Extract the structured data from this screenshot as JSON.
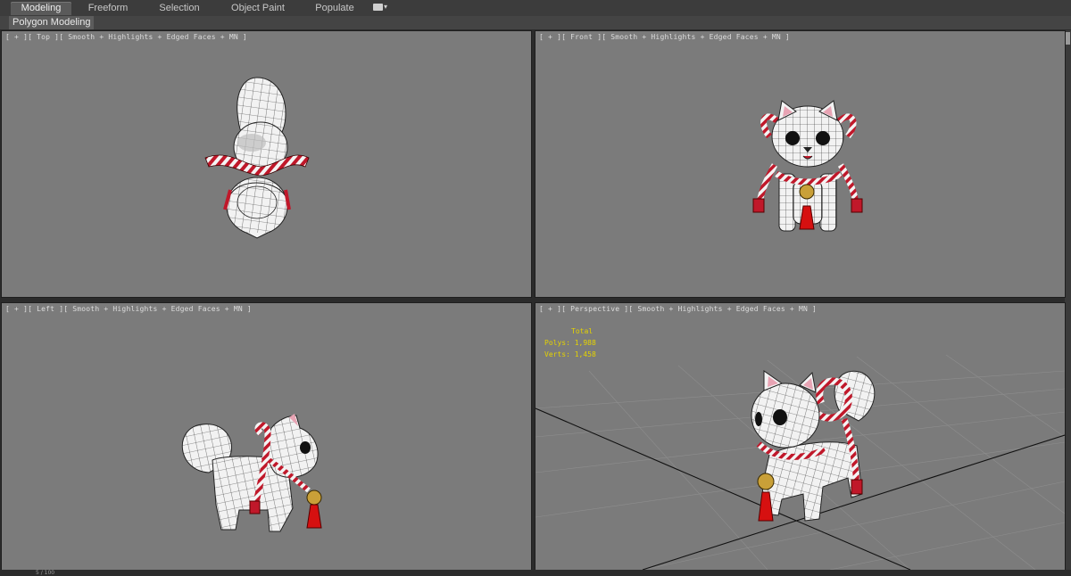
{
  "ribbon": {
    "tabs": [
      {
        "label": "Modeling",
        "active": true
      },
      {
        "label": "Freeform",
        "active": false
      },
      {
        "label": "Selection",
        "active": false
      },
      {
        "label": "Object Paint",
        "active": false
      },
      {
        "label": "Populate",
        "active": false
      }
    ],
    "dropdown_icon": "display-options-icon"
  },
  "panel": {
    "label": "Polygon Modeling"
  },
  "viewports": {
    "top": {
      "label": "[ + ][ Top ][ Smooth + Highlights + Edged Faces + MN ]"
    },
    "front": {
      "label": "[ + ][ Front ][ Smooth + Highlights + Edged Faces + MN ]"
    },
    "left": {
      "label": "[ + ][ Left ][ Smooth + Highlights + Edged Faces + MN ]"
    },
    "perspective": {
      "label": "[ + ][ Perspective ][ Smooth + Highlights + Edged Faces + MN ]",
      "stats": {
        "title": "Total",
        "polys": "Polys:  1,988",
        "verts": "Verts:  1,458"
      }
    }
  },
  "statusbar": {
    "text": "5 / 100"
  },
  "colors": {
    "viewport_bg": "#7b7b7b",
    "model_white": "#f2f2f2",
    "wire": "#2a2a2a",
    "rope_red": "#c0182a",
    "tassel_red": "#d61010",
    "bell_gold": "#c9a038",
    "stats_yellow": "#e5d300"
  }
}
